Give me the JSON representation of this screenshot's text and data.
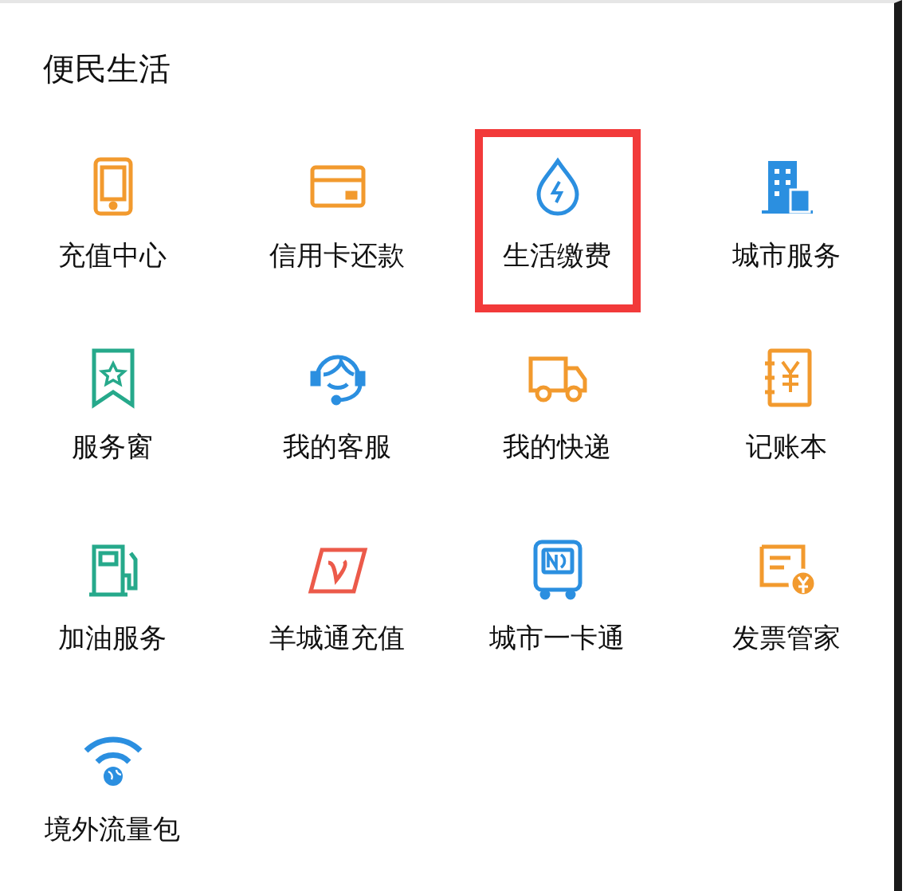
{
  "section": {
    "title": "便民生活"
  },
  "services": [
    {
      "label": "充值中心",
      "color": "#f29a2e",
      "highlighted": false
    },
    {
      "label": "信用卡还款",
      "color": "#f29a2e",
      "highlighted": false
    },
    {
      "label": "生活缴费",
      "color": "#2b8fe0",
      "highlighted": true
    },
    {
      "label": "城市服务",
      "color": "#2b8fe0",
      "highlighted": false
    },
    {
      "label": "服务窗",
      "color": "#26a98b",
      "highlighted": false
    },
    {
      "label": "我的客服",
      "color": "#2b8fe0",
      "highlighted": false
    },
    {
      "label": "我的快递",
      "color": "#f29a2e",
      "highlighted": false
    },
    {
      "label": "记账本",
      "color": "#f29a2e",
      "highlighted": false
    },
    {
      "label": "加油服务",
      "color": "#26a98b",
      "highlighted": false
    },
    {
      "label": "羊城通充值",
      "color": "#ec5a4a",
      "highlighted": false
    },
    {
      "label": "城市一卡通",
      "color": "#2b8fe0",
      "highlighted": false
    },
    {
      "label": "发票管家",
      "color": "#f29a2e",
      "highlighted": false
    },
    {
      "label": "境外流量包",
      "color": "#2b8fe0",
      "highlighted": false
    }
  ]
}
